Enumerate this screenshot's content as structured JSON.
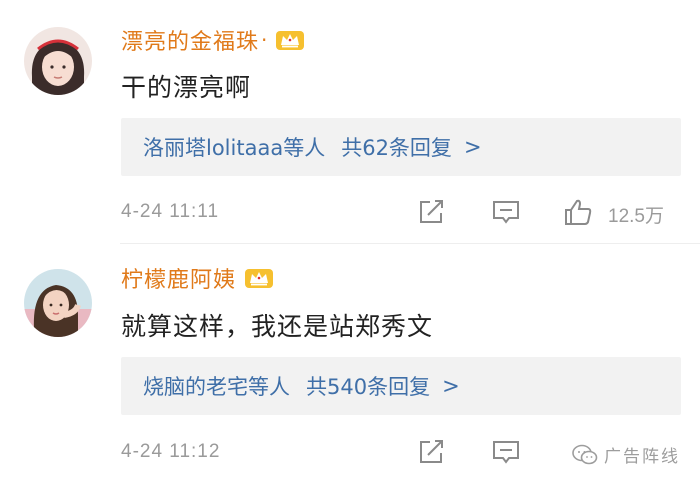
{
  "comments": [
    {
      "username": "漂亮的金福珠",
      "name_suffix": "·",
      "text": "干的漂亮啊",
      "reply_users": "洛丽塔lolitaaa等人",
      "reply_count": "共62条回复",
      "reply_arrow": ">",
      "time": "4-24 11:11",
      "likes": "12.5万",
      "avatar_icon": "user-avatar",
      "badge_icon": "crown-badge"
    },
    {
      "username": "柠檬鹿阿姨",
      "text": "就算这样，我还是站郑秀文",
      "reply_users": "烧脑的老宅等人",
      "reply_count": "共540条回复",
      "reply_arrow": ">",
      "time": "4-24 11:12",
      "avatar_icon": "user-avatar",
      "badge_icon": "crown-badge"
    }
  ],
  "watermark": {
    "text": "广告阵线",
    "icon": "wechat-icon"
  },
  "colors": {
    "username": "#e07a1a",
    "reply_link": "#3f6fa8",
    "reply_bg": "#f2f2f2",
    "meta": "#9a9a9a"
  }
}
